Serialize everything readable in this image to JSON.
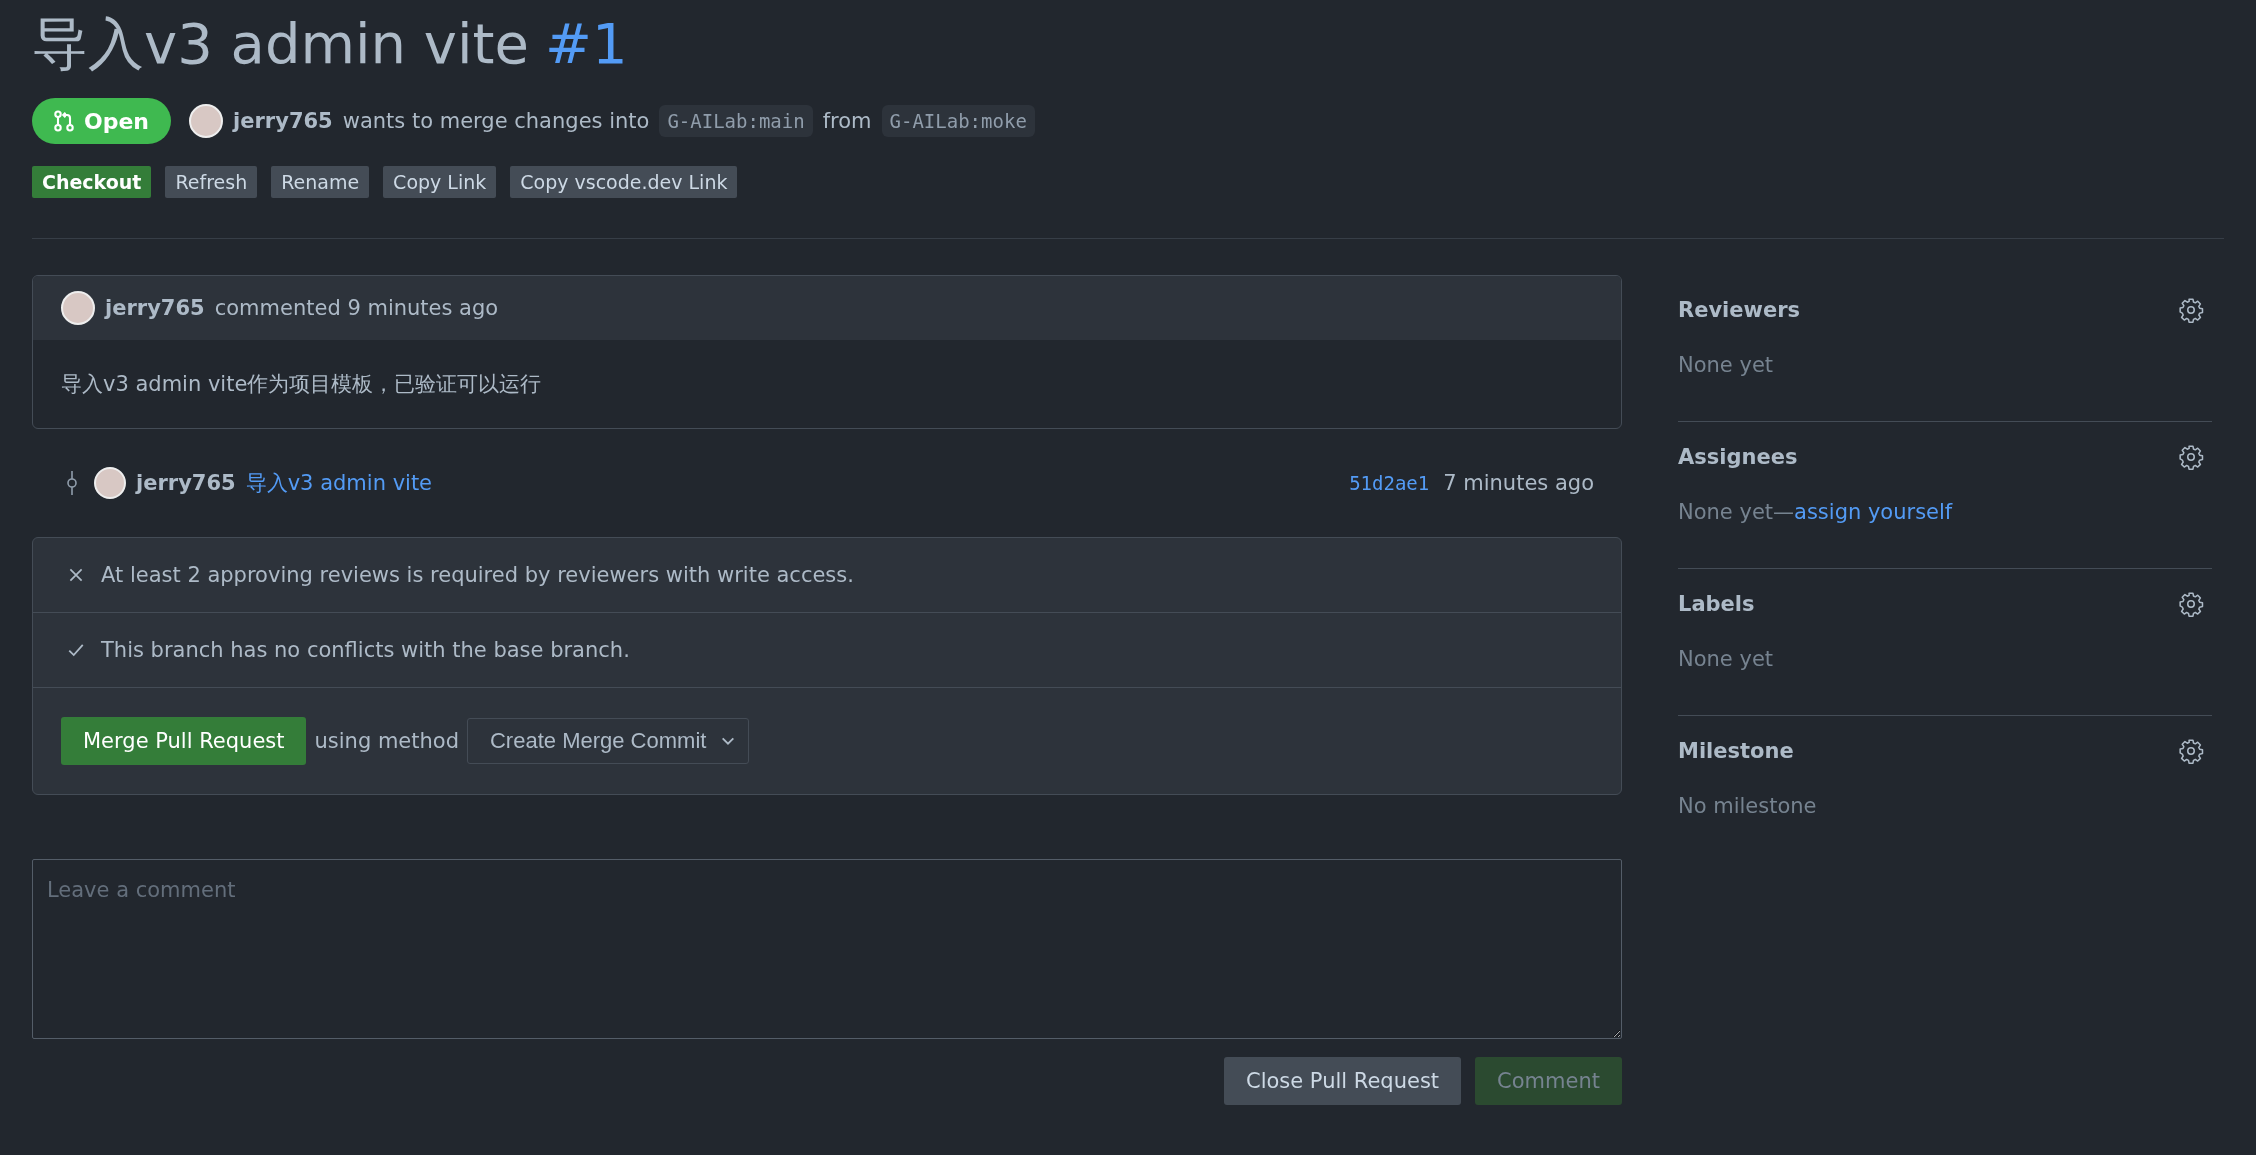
{
  "title": {
    "text": "导入v3 admin vite",
    "number": "#1"
  },
  "status": {
    "label": "Open",
    "open": true
  },
  "summary": {
    "author": "jerry765",
    "text": "wants to merge changes into",
    "base": "G-AILab:main",
    "from_word": "from",
    "head": "G-AILab:moke"
  },
  "actions": [
    {
      "label": "Checkout",
      "kind": "primary"
    },
    {
      "label": "Refresh",
      "kind": "secondary"
    },
    {
      "label": "Rename",
      "kind": "secondary"
    },
    {
      "label": "Copy Link",
      "kind": "secondary"
    },
    {
      "label": "Copy vscode.dev Link",
      "kind": "secondary"
    }
  ],
  "comment": {
    "author": "jerry765",
    "meta": "commented 9 minutes ago",
    "body": "导入v3 admin vite作为项目模板，已验证可以运行"
  },
  "commit": {
    "author": "jerry765",
    "message": "导入v3 admin vite",
    "sha": "51d2ae1",
    "time": "7 minutes ago"
  },
  "checks": [
    {
      "kind": "fail",
      "text": "At least 2 approving reviews is required by reviewers with write access."
    },
    {
      "kind": "pass",
      "text": "This branch has no conflicts with the base branch."
    }
  ],
  "merge": {
    "button": "Merge Pull Request",
    "using": "using method",
    "method": "Create Merge Commit"
  },
  "new_comment": {
    "placeholder": "Leave a comment",
    "close_button": "Close Pull Request",
    "comment_button": "Comment",
    "comment_disabled": true
  },
  "sidebar": [
    {
      "title": "Reviewers",
      "value": "None yet"
    },
    {
      "title": "Assignees",
      "value": "None yet—",
      "link": "assign yourself"
    },
    {
      "title": "Labels",
      "value": "None yet"
    },
    {
      "title": "Milestone",
      "value": "No milestone"
    }
  ]
}
